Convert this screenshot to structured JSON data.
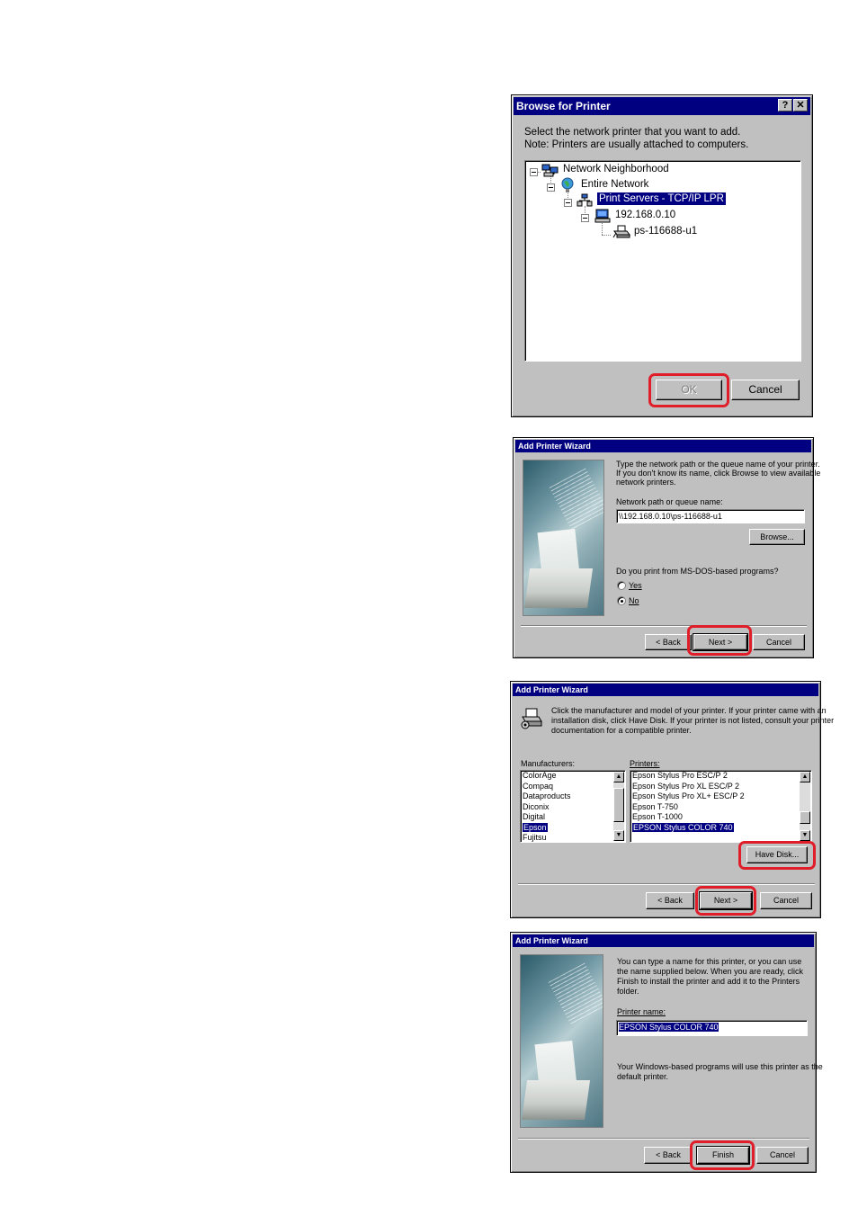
{
  "dialog1": {
    "title": "Browse for Printer",
    "help_btn": "?",
    "close_btn": "✕",
    "instruction_line1": "Select the network printer that you want to add.",
    "instruction_line2": "Note: Printers are usually attached to computers.",
    "tree": [
      {
        "label": "Network Neighborhood",
        "icon": "network-neighborhood-icon"
      },
      {
        "label": "Entire Network",
        "icon": "globe-icon"
      },
      {
        "label": "Print Servers - TCP/IP LPR",
        "icon": "print-server-icon",
        "selected": true
      },
      {
        "label": "192.168.0.10",
        "icon": "computer-icon"
      },
      {
        "label": "ps-116688-u1",
        "icon": "printer-icon"
      }
    ],
    "ok_label": "OK",
    "cancel_label": "Cancel"
  },
  "dialog2": {
    "title": "Add Printer Wizard",
    "intro_line1": "Type the network path or the queue name of your printer.",
    "intro_line2": "If you don't know its name, click Browse to view available",
    "intro_line3": "network printers.",
    "path_label": "Network path or queue name:",
    "path_value": "\\\\192.168.0.10\\ps-116688-u1",
    "browse_label": "Browse...",
    "msdos_question": "Do you print from MS-DOS-based programs?",
    "yes_label": "Yes",
    "no_label": "No",
    "selected_option": "No",
    "back_label": "< Back",
    "next_label": "Next >",
    "cancel_label": "Cancel"
  },
  "dialog3": {
    "title": "Add Printer Wizard",
    "intro_line1": "Click the manufacturer and model of your printer. If your printer came with an",
    "intro_line2": "installation disk, click Have Disk. If your printer is not listed, consult your printer",
    "intro_line3": "documentation for a compatible printer.",
    "manufacturers_label": "Manufacturers:",
    "manufacturers": [
      "ColorAge",
      "Compaq",
      "Dataproducts",
      "Diconix",
      "Digital",
      "Epson",
      "Fujitsu"
    ],
    "selected_manufacturer": "Epson",
    "printers_label": "Printers:",
    "printers": [
      "Epson Stylus Pro ESC/P 2",
      "Epson Stylus Pro XL ESC/P 2",
      "Epson Stylus Pro XL+ ESC/P 2",
      "Epson T-750",
      "Epson T-1000",
      "EPSON Stylus COLOR 740"
    ],
    "selected_printer": "EPSON Stylus COLOR 740",
    "have_disk_label": "Have Disk...",
    "back_label": "< Back",
    "next_label": "Next >",
    "cancel_label": "Cancel"
  },
  "dialog4": {
    "title": "Add Printer Wizard",
    "intro_line1": "You can type a name for this printer, or you can use",
    "intro_line2": "the name supplied below. When you are ready, click",
    "intro_line3": "Finish to install the printer and add it to the Printers",
    "intro_line4": "folder.",
    "name_label": "Printer name:",
    "name_value": "EPSON Stylus COLOR 740",
    "default_line1": "Your Windows-based programs will use this printer as the",
    "default_line2": "default printer.",
    "back_label": "< Back",
    "finish_label": "Finish",
    "cancel_label": "Cancel"
  }
}
